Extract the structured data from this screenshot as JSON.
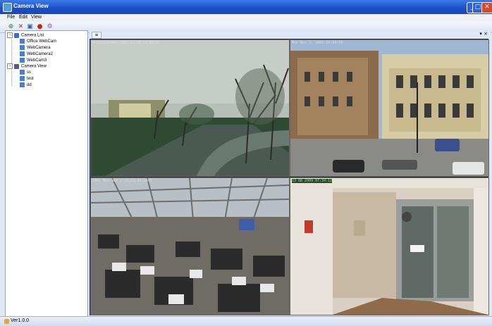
{
  "window": {
    "title": "Camera View",
    "min_label": "_",
    "max_label": "□",
    "close_label": "✕"
  },
  "menu": {
    "file": "File",
    "edit": "Edit",
    "view": "View"
  },
  "toolbar": {
    "add_label": "⊕",
    "delete_label": "✕",
    "save_label": "▣",
    "record_label": "●",
    "options_label": "⚙"
  },
  "tree": {
    "camera_list_label": "Camera List",
    "cameras": [
      "Office WebCam",
      "WebCamera",
      "WebCamera2",
      "WebCam3"
    ],
    "camera_view_label": "Camera View",
    "views": [
      "ss",
      "test",
      "dd"
    ],
    "expand_symbol": "−"
  },
  "doc": {
    "tab_label": "≡",
    "pin_label": "▾ ×"
  },
  "cameras": [
    {
      "label": "Kristinehamn 2003-11-02 11:03:5C"
    },
    {
      "label": "Mon Nov 2, 2003 10:03:56"
    },
    {
      "label": "JACC Mon Nov 2 10:53:39 2003"
    },
    {
      "label": "13  08  2009  07:34:12"
    }
  ],
  "status": {
    "version": "Ver1.0.0"
  },
  "colors": {
    "titlebar": "#1a4fc9",
    "close": "#d84a2e",
    "panel_bg": "#dfe8f6"
  }
}
